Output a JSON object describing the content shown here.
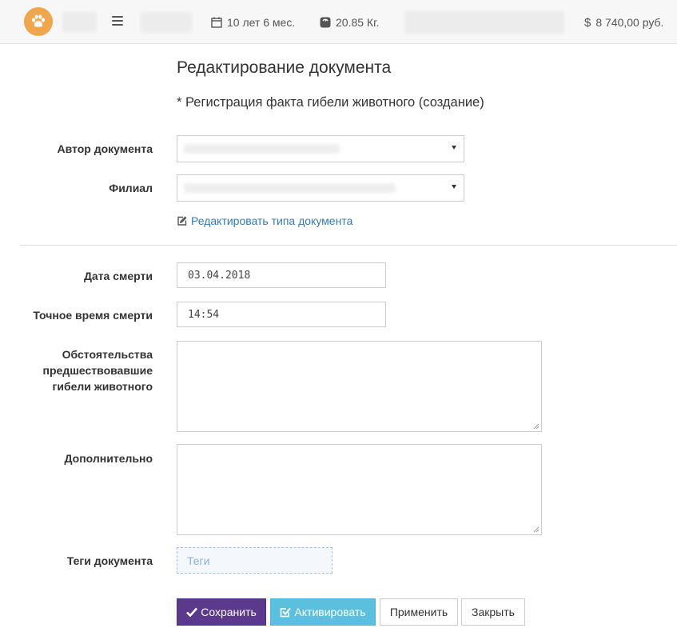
{
  "topbar": {
    "age": "10 лет 6 мес.",
    "weight": "20.85 Кг.",
    "balance": "8 740,00 руб.",
    "icons": [
      "paw-icon",
      "hamburger-icon",
      "calendar-icon",
      "scale-icon",
      "dollar-icon"
    ]
  },
  "form": {
    "title": "Редактирование документа",
    "subtitle": "* Регистрация факта гибели животного (создание)",
    "author_label": "Автор документа",
    "branch_label": "Филиал",
    "edit_type_link": "Редактировать типа документа",
    "death_date_label": "Дата смерти",
    "death_date_value": "03.04.2018",
    "death_time_label": "Точное время смерти",
    "death_time_value": "14:54",
    "circumstances_label": "Обстоятельства предшествовавшие гибели животного",
    "additional_label": "Дополнительно",
    "tags_label": "Теги документа",
    "tags_placeholder": "Теги"
  },
  "buttons": {
    "save": "Сохранить",
    "activate": "Активировать",
    "apply": "Применить",
    "close": "Закрыть"
  },
  "colors": {
    "logo": "#f0a64d",
    "save_button": "#5b3a8e",
    "activate_button": "#5bc0de",
    "link": "#337ab7"
  }
}
